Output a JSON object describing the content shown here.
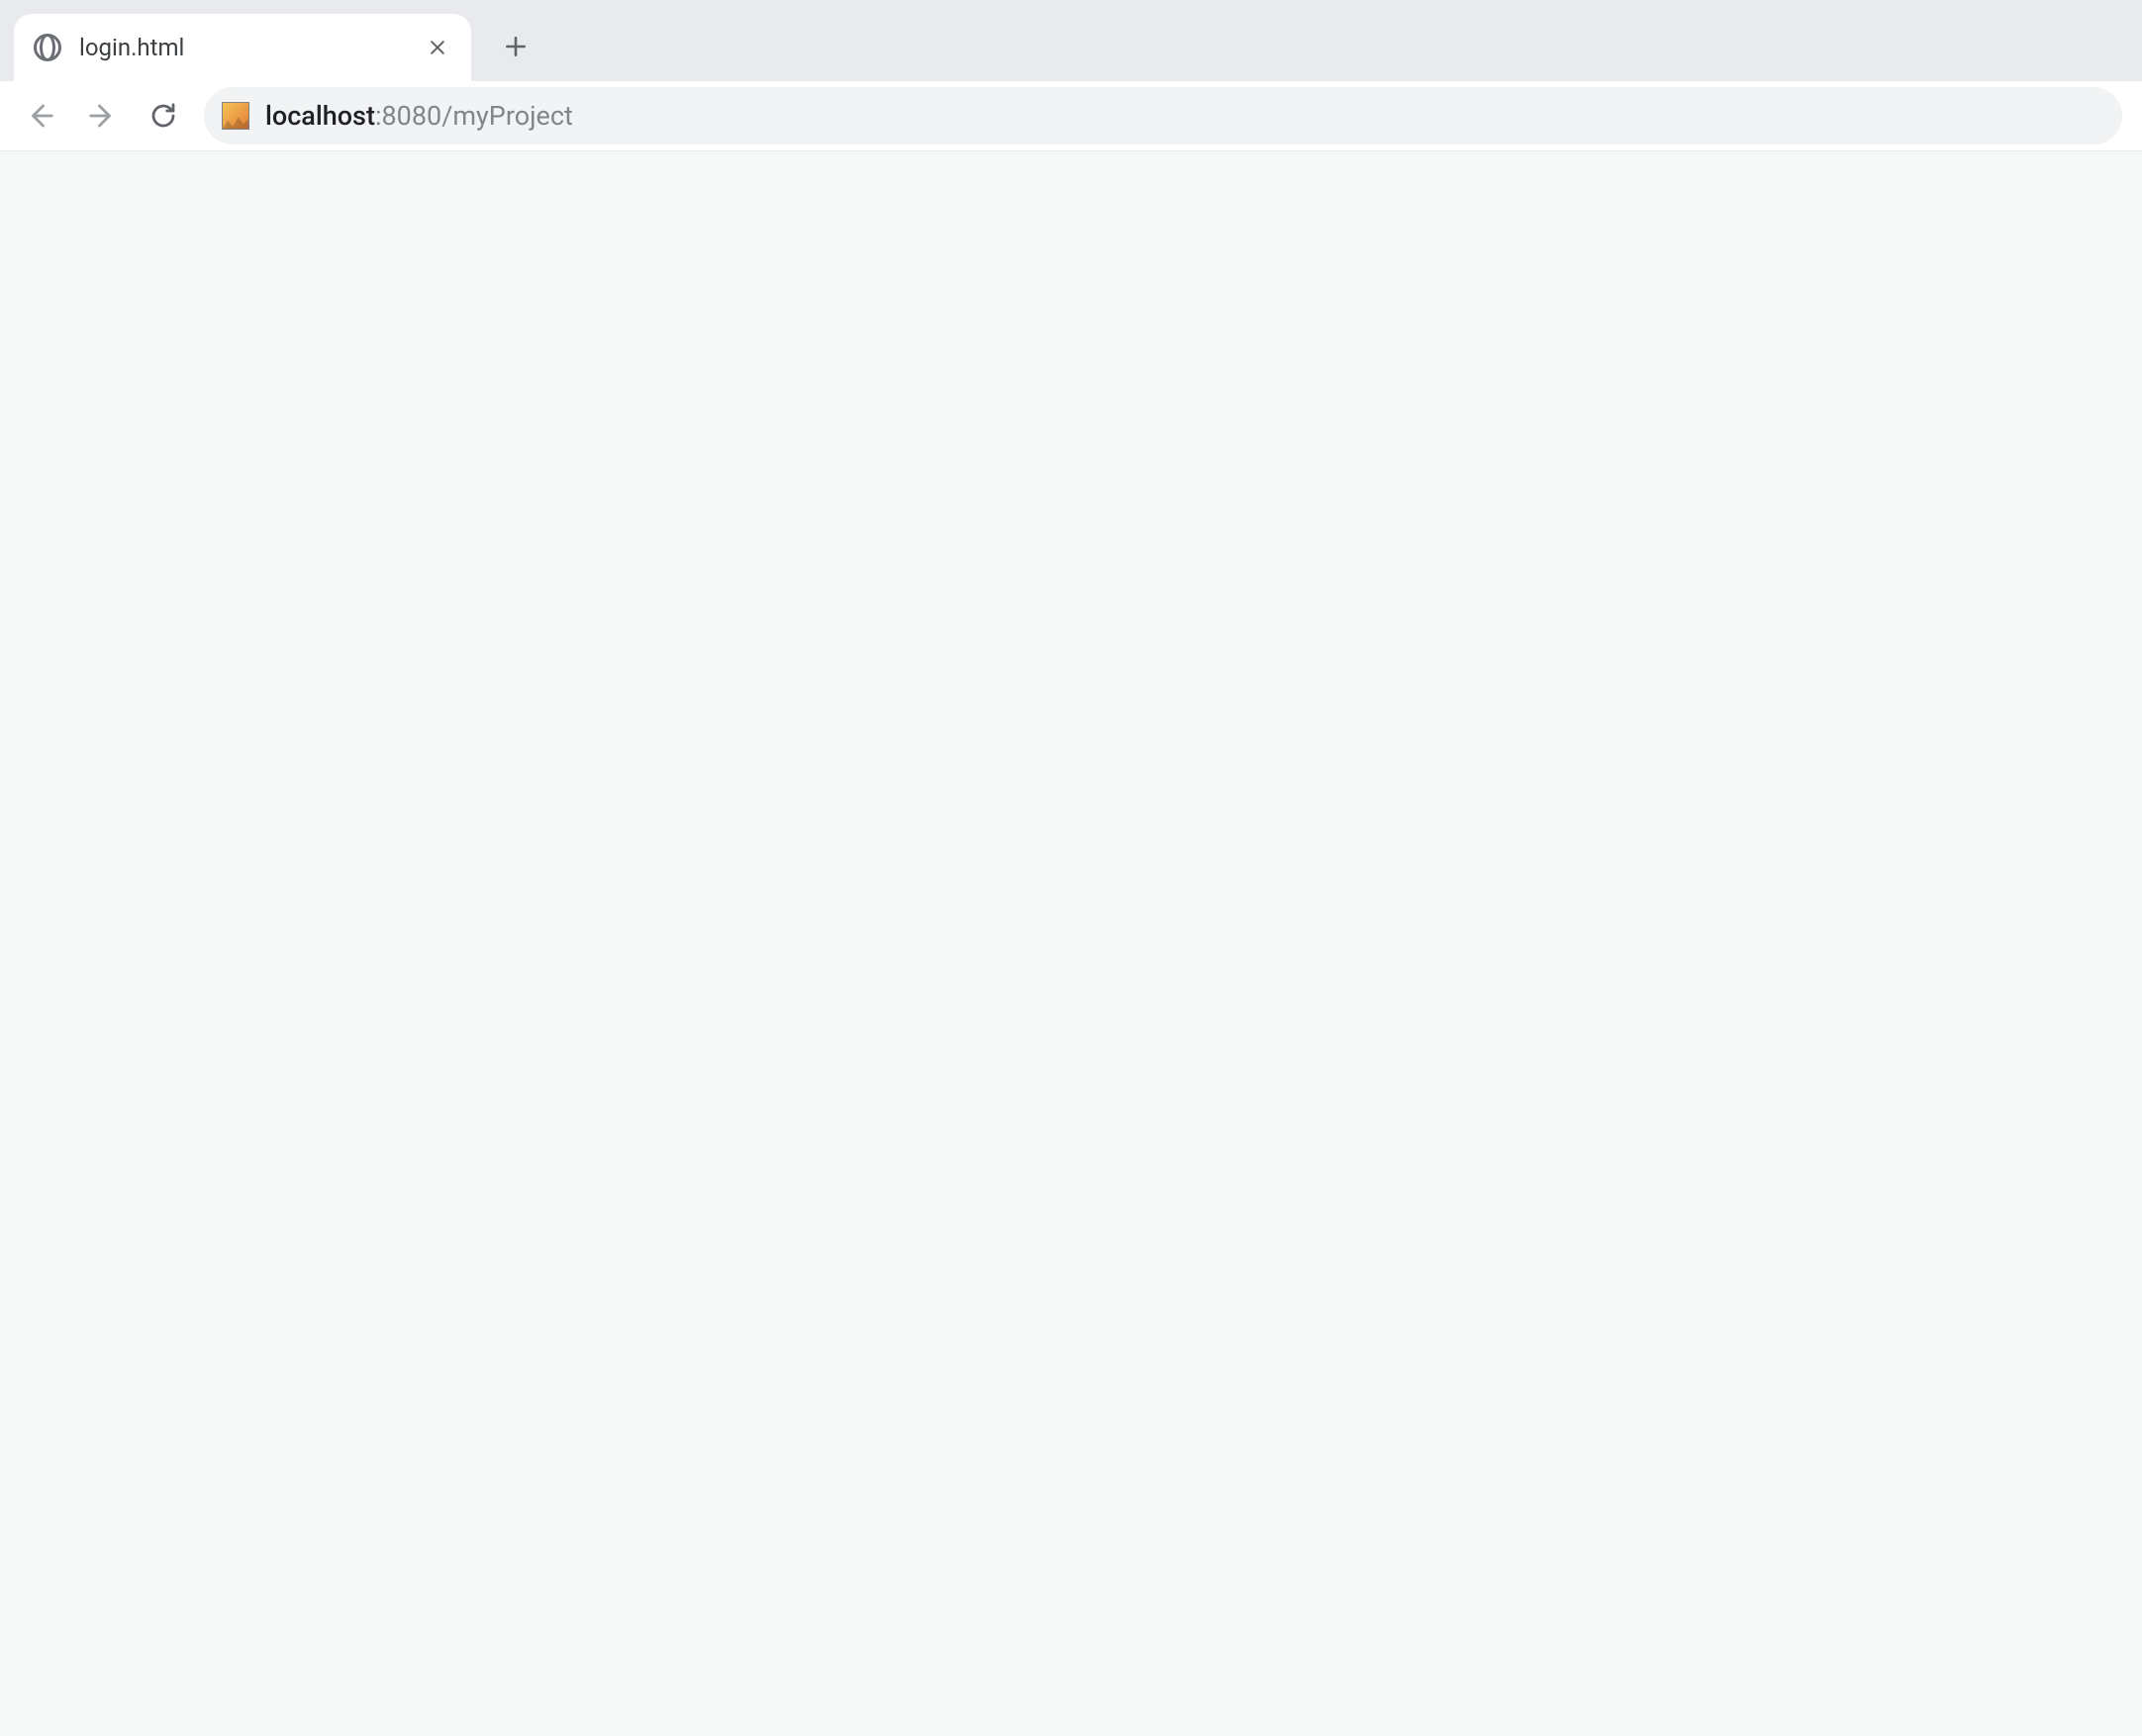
{
  "tabs": [
    {
      "title": "login.html"
    }
  ],
  "url": {
    "host": "localhost",
    "rest": ":8080/myProject"
  }
}
